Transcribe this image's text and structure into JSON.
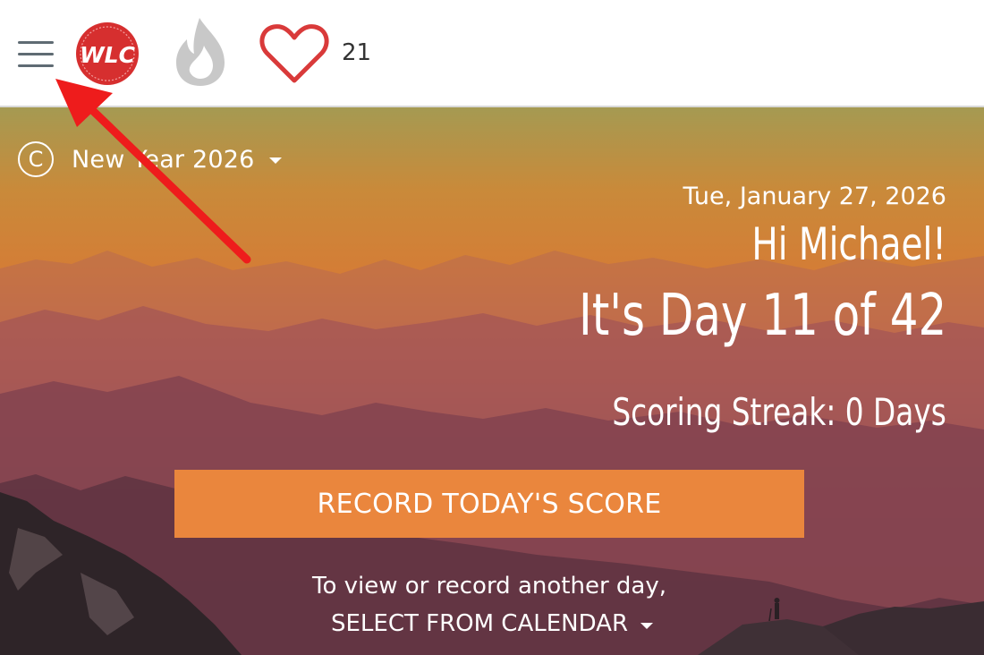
{
  "header": {
    "menu_icon": "hamburger-menu-icon",
    "logo_text": "WLC",
    "logo_color": "#d62f2f",
    "streak_icon": "flame-icon",
    "heart_icon": "heart-icon",
    "heart_count": "21"
  },
  "hero": {
    "challenge": {
      "icon_letter": "C",
      "name": "New Year 2026"
    },
    "date": "Tue, January 27, 2026",
    "greeting": "Hi Michael!",
    "day_progress": "It's Day 11 of 42",
    "streak": "Scoring Streak: 0 Days",
    "record_button": "RECORD TODAY'S SCORE",
    "other_day_prompt": "To view or record another day,",
    "calendar_link": "SELECT FROM CALENDAR"
  },
  "colors": {
    "accent_orange": "#ea863d",
    "heart_red": "#d93a3a",
    "flame_gray": "#c8c8c8",
    "annotation_arrow": "#ee1c1c"
  }
}
